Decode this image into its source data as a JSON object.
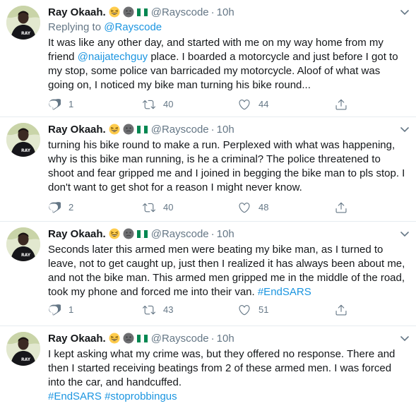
{
  "colors": {
    "link": "#1b95e0",
    "secondary": "#657786",
    "text": "#14171a",
    "divider": "#e6ecf0"
  },
  "author": {
    "name": "Ray Okaah.",
    "handle": "@Rayscode",
    "emojis": [
      "grinning-squint-emoji",
      "dark-circle-emoji",
      "nigeria-flag"
    ]
  },
  "tweets": [
    {
      "time": "10h",
      "replying_prefix": "Replying to ",
      "replying_to": "@Rayscode",
      "text_1": "It was like any other day, and started with me on my way home from my friend ",
      "mention": "@naijatechguy",
      "text_2": " place. I boarded a motorcycle and just before I got to my stop, some police van barricaded my motorcycle. Aloof of what was going on, I noticed my bike man turning his bike round...",
      "replies": "1",
      "retweets": "40",
      "likes": "44"
    },
    {
      "time": "10h",
      "text": "turning his bike round to make a run. Perplexed with what was happening, why is this bike man running, is he a criminal? The police threatened to shoot and fear gripped me and I joined in begging the bike man to pls stop. I don't want to get shot for a reason I might never know.",
      "replies": "2",
      "retweets": "40",
      "likes": "48"
    },
    {
      "time": "10h",
      "text": "Seconds later this armed men were beating my bike man, as I turned to leave, not to get caught up, just then I realized it has always been about me, and not the bike man. This armed men gripped me in the middle of the road, took my phone and forced me into their van.  ",
      "hashtag": "#EndSARS",
      "replies": "1",
      "retweets": "43",
      "likes": "51"
    },
    {
      "time": "10h",
      "text": "I kept asking what my crime was, but they offered no response. There and then I started receiving beatings from 2 of these armed men. I was forced into the car, and handcuffed.",
      "hashtag_1": "#EndSARS",
      "hashtag_2": "#stoprobbingus"
    }
  ]
}
